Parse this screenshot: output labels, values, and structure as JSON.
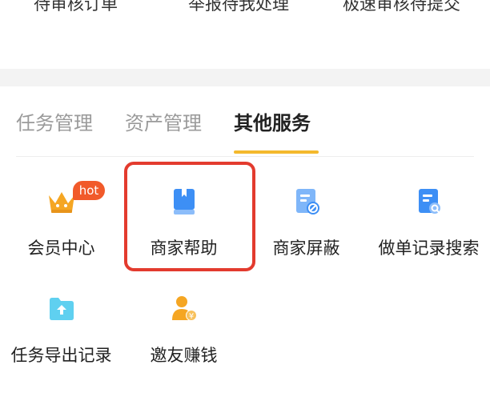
{
  "top_row": {
    "items": [
      "待审核订单",
      "举报待我处理",
      "极速审核待提交"
    ]
  },
  "tabs": [
    {
      "label": "任务管理",
      "active": false
    },
    {
      "label": "资产管理",
      "active": false
    },
    {
      "label": "其他服务",
      "active": true
    }
  ],
  "services": [
    {
      "label": "会员中心",
      "icon": "crown-icon",
      "badge": "hot"
    },
    {
      "label": "商家帮助",
      "icon": "help-book-icon"
    },
    {
      "label": "商家屏蔽",
      "icon": "block-document-icon"
    },
    {
      "label": "做单记录搜索",
      "icon": "search-document-icon"
    },
    {
      "label": "任务导出记录",
      "icon": "export-folder-icon"
    },
    {
      "label": "邀友赚钱",
      "icon": "invite-money-icon"
    }
  ],
  "colors": {
    "accent": "#f4b92d",
    "highlight": "#e33b2e",
    "badge": "#f15a2a",
    "icon_blue": "#3d8ff5",
    "icon_orange": "#f5a623"
  }
}
